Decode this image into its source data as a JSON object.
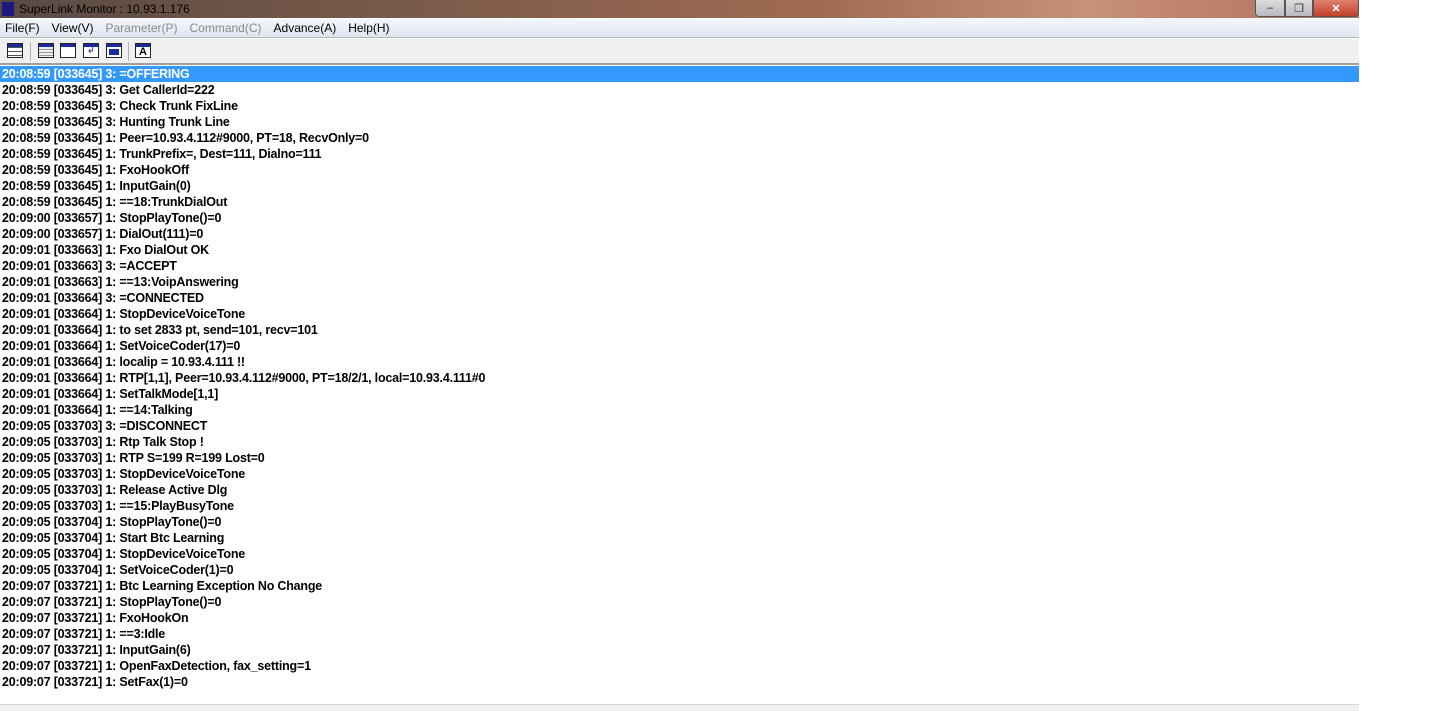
{
  "window": {
    "title": "SuperLink Monitor : 10.93.1.176",
    "min": "–",
    "max": "❐",
    "close": "✕"
  },
  "menu": [
    {
      "label": "File(F)",
      "enabled": true
    },
    {
      "label": "View(V)",
      "enabled": true
    },
    {
      "label": "Parameter(P)",
      "enabled": false
    },
    {
      "label": "Command(C)",
      "enabled": false
    },
    {
      "label": "Advance(A)",
      "enabled": true
    },
    {
      "label": "Help(H)",
      "enabled": true
    }
  ],
  "toolbar": {
    "font_label": "A"
  },
  "log": {
    "selected_index": 0,
    "lines": [
      "20:08:59 [033645] 3: =OFFERING",
      "20:08:59 [033645] 3: Get CallerId=222",
      "20:08:59 [033645] 3: Check Trunk FixLine",
      "20:08:59 [033645] 3: Hunting Trunk Line",
      "20:08:59 [033645] 1: Peer=10.93.4.112#9000, PT=18, RecvOnly=0",
      "20:08:59 [033645] 1: TrunkPrefix=, Dest=111, Dialno=111",
      "20:08:59 [033645] 1: FxoHookOff",
      "20:08:59 [033645] 1: InputGain(0)",
      "20:08:59 [033645] 1: ==18:TrunkDialOut",
      "20:09:00 [033657] 1: StopPlayTone()=0",
      "20:09:00 [033657] 1: DialOut(111)=0",
      "20:09:01 [033663] 1: Fxo DialOut OK",
      "20:09:01 [033663] 3: =ACCEPT",
      "20:09:01 [033663] 1: ==13:VoipAnswering",
      "20:09:01 [033664] 3: =CONNECTED",
      "20:09:01 [033664] 1: StopDeviceVoiceTone",
      "20:09:01 [033664] 1: to set 2833 pt, send=101, recv=101",
      "20:09:01 [033664] 1: SetVoiceCoder(17)=0",
      "20:09:01 [033664] 1: localip = 10.93.4.111 !!",
      "20:09:01 [033664] 1: RTP[1,1], Peer=10.93.4.112#9000, PT=18/2/1, local=10.93.4.111#0",
      "20:09:01 [033664] 1: SetTalkMode[1,1]",
      "20:09:01 [033664] 1: ==14:Talking",
      "20:09:05 [033703] 3: =DISCONNECT",
      "20:09:05 [033703] 1: Rtp Talk Stop !",
      "20:09:05 [033703] 1: RTP S=199 R=199 Lost=0",
      "20:09:05 [033703] 1: StopDeviceVoiceTone",
      "20:09:05 [033703] 1: Release Active Dlg",
      "20:09:05 [033703] 1: ==15:PlayBusyTone",
      "20:09:05 [033704] 1: StopPlayTone()=0",
      "20:09:05 [033704] 1: Start Btc Learning",
      "20:09:05 [033704] 1: StopDeviceVoiceTone",
      "20:09:05 [033704] 1: SetVoiceCoder(1)=0",
      "20:09:07 [033721] 1: Btc Learning Exception No Change",
      "20:09:07 [033721] 1: StopPlayTone()=0",
      "20:09:07 [033721] 1: FxoHookOn",
      "20:09:07 [033721] 1: ==3:Idle",
      "20:09:07 [033721] 1: InputGain(6)",
      "20:09:07 [033721] 1: OpenFaxDetection, fax_setting=1",
      "20:09:07 [033721] 1: SetFax(1)=0"
    ]
  },
  "colors": {
    "selection": "#3399ff"
  }
}
